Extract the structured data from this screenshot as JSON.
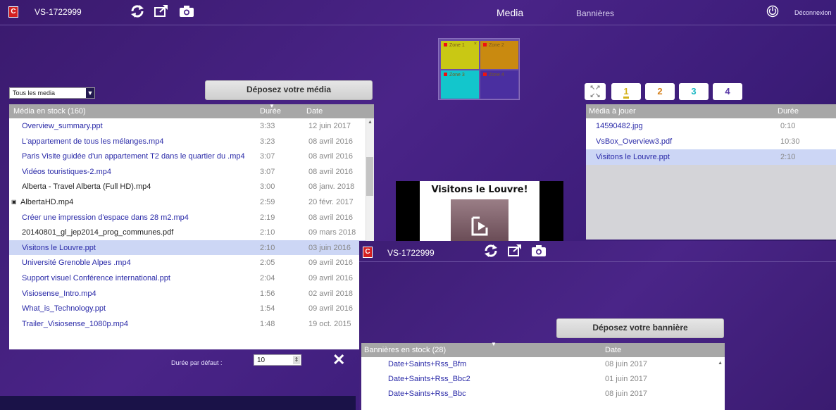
{
  "app": {
    "logo": "C",
    "device_id": "VS-1722999",
    "nav": {
      "media": "Media",
      "banners": "Bannières"
    },
    "logout": "Déconnexion"
  },
  "toolbar_icons": [
    "refresh-icon",
    "external-screen-icon",
    "camera-icon",
    "power-icon"
  ],
  "left": {
    "filter_value": "Tous les media",
    "drop_label": "Déposez votre média",
    "table": {
      "col_name": "Média en stock (160)",
      "col_duration": "Durée",
      "col_date": "Date",
      "rows": [
        {
          "name": "Overview_summary.ppt",
          "duration": "3:33",
          "date": "12 juin 2017"
        },
        {
          "name": "L'appartement de tous les mélanges.mp4",
          "duration": "3:23",
          "date": "08 avril 2016"
        },
        {
          "name": "Paris Visite guidée d'un appartement T2 dans le quartier du .mp4",
          "duration": "3:07",
          "date": "08 avril 2016"
        },
        {
          "name": "Vidéos touristiques-2.mp4",
          "duration": "3:07",
          "date": "08 avril 2016"
        },
        {
          "name": "Alberta - Travel Alberta (Full HD).mp4",
          "duration": "3:00",
          "date": "08 janv. 2018"
        },
        {
          "name": "AlbertaHD.mp4",
          "duration": "2:59",
          "date": "20 févr. 2017"
        },
        {
          "name": "Créer une impression d'espace dans 28 m2.mp4",
          "duration": "2:19",
          "date": "08 avril 2016"
        },
        {
          "name": "20140801_gl_jep2014_prog_communes.pdf",
          "duration": "2:10",
          "date": "09 mars 2018"
        },
        {
          "name": "Visitons le Louvre.ppt",
          "duration": "2:10",
          "date": "03 juin 2016"
        },
        {
          "name": "Université Grenoble Alpes .mp4",
          "duration": "2:05",
          "date": "09 avril 2016"
        },
        {
          "name": "Support visuel Conférence international.ppt",
          "duration": "2:04",
          "date": "09 avril 2016"
        },
        {
          "name": "Visiosense_Intro.mp4",
          "duration": "1:56",
          "date": "02 avril 2018"
        },
        {
          "name": "What_is_Technology.ppt",
          "duration": "1:54",
          "date": "09 avril 2016"
        },
        {
          "name": "Trailer_Visiosense_1080p.mp4",
          "duration": "1:48",
          "date": "19 oct. 2015"
        }
      ]
    },
    "default_duration_label": "Durée par défaut :",
    "default_duration_value": "10"
  },
  "zones": [
    {
      "label": "Zone 1",
      "color": "#c9c814"
    },
    {
      "label": "Zone 2",
      "color": "#c98a10"
    },
    {
      "label": "Zone 3",
      "color": "#13c6cc"
    },
    {
      "label": "Zone 4",
      "color": "#4a2fa0"
    }
  ],
  "preview": {
    "title": "Visitons le Louvre!"
  },
  "right": {
    "pages": [
      {
        "label": "1",
        "color": "#d4b21a"
      },
      {
        "label": "2",
        "color": "#d47f1a"
      },
      {
        "label": "3",
        "color": "#1ab7c4"
      },
      {
        "label": "4",
        "color": "#5a3aa8"
      }
    ],
    "table": {
      "col_name": "Média à jouer",
      "col_duration": "Durée",
      "rows": [
        {
          "name": "14590482.jpg",
          "duration": "0:10"
        },
        {
          "name": "VsBox_Overview3.pdf",
          "duration": "10:30"
        },
        {
          "name": "Visitons le Louvre.ppt",
          "duration": "2:10"
        }
      ]
    }
  },
  "overlay": {
    "device_id": "VS-1722999",
    "drop_label": "Déposez votre bannière",
    "table": {
      "col_name": "Bannières en stock  (28)",
      "col_date": "Date",
      "rows": [
        {
          "name": "Date+Saints+Rss_Bfm",
          "date": "08 juin 2017"
        },
        {
          "name": "Date+Saints+Rss_Bbc2",
          "date": "01 juin 2017"
        },
        {
          "name": "Date+Saints+Rss_Bbc",
          "date": "08 juin 2017"
        }
      ]
    }
  }
}
